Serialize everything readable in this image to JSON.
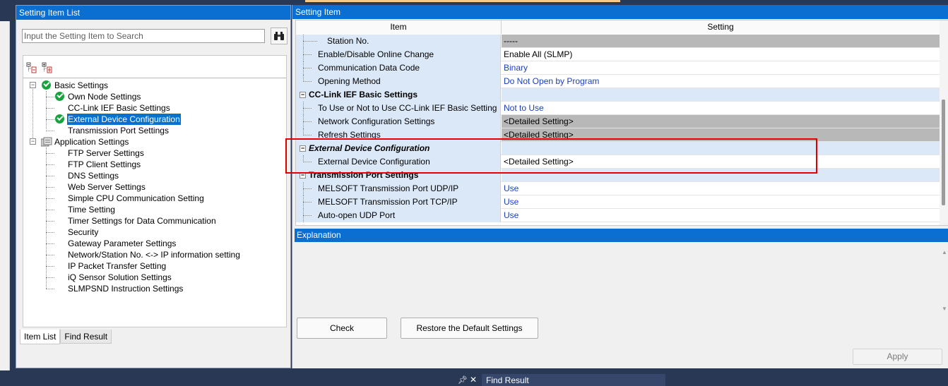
{
  "left_panel": {
    "title": "Setting Item List",
    "search_placeholder": "Input the Setting Item to Search",
    "tree": [
      {
        "label": "Basic Settings"
      },
      {
        "label": "Own Node Settings"
      },
      {
        "label": "CC-Link IEF Basic Settings"
      },
      {
        "label": "External Device Configuration"
      },
      {
        "label": "Transmission Port Settings"
      },
      {
        "label": "Application Settings"
      },
      {
        "label": "FTP Server Settings"
      },
      {
        "label": "FTP Client Settings"
      },
      {
        "label": "DNS Settings"
      },
      {
        "label": "Web Server Settings"
      },
      {
        "label": "Simple CPU Communication Setting"
      },
      {
        "label": "Time Setting"
      },
      {
        "label": "Timer Settings for Data Communication"
      },
      {
        "label": "Security"
      },
      {
        "label": "Gateway Parameter Settings"
      },
      {
        "label": "Network/Station No. <-> IP information setting"
      },
      {
        "label": "IP Packet Transfer Setting"
      },
      {
        "label": "iQ Sensor Solution Settings"
      },
      {
        "label": "SLMPSND Instruction Settings"
      }
    ],
    "tabs": [
      "Item List",
      "Find Result"
    ]
  },
  "right_panel": {
    "title": "Setting Item",
    "columns": [
      "Item",
      "Setting"
    ],
    "rows": [
      {
        "item": "Station No.",
        "value": "-----"
      },
      {
        "item": "Enable/Disable Online Change",
        "value": "Enable All (SLMP)"
      },
      {
        "item": "Communication Data Code",
        "value": "Binary"
      },
      {
        "item": "Opening Method",
        "value": "Do Not Open by Program"
      },
      {
        "item": "CC-Link IEF Basic Settings",
        "value": ""
      },
      {
        "item": "To Use or Not to Use CC-Link IEF Basic Setting",
        "value": "Not to Use"
      },
      {
        "item": "Network Configuration Settings",
        "value": "<Detailed Setting>"
      },
      {
        "item": "Refresh Settings",
        "value": "<Detailed Setting>"
      },
      {
        "item": "External Device Configuration",
        "value": ""
      },
      {
        "item": "External Device Configuration",
        "value": "<Detailed Setting>"
      },
      {
        "item": "Transmission Port Settings",
        "value": ""
      },
      {
        "item": "MELSOFT Transmission Port UDP/IP",
        "value": "Use"
      },
      {
        "item": "MELSOFT Transmission Port TCP/IP",
        "value": "Use"
      },
      {
        "item": "Auto-open UDP Port",
        "value": "Use"
      }
    ],
    "explanation_title": "Explanation",
    "buttons": {
      "check": "Check",
      "restore": "Restore the Default Settings",
      "apply": "Apply"
    }
  },
  "bottom_bar": {
    "find_result": "Find Result"
  },
  "colors": {
    "accent": "#0a6fd0",
    "link_value": "#1a3fc0",
    "highlight": "#e00000"
  }
}
